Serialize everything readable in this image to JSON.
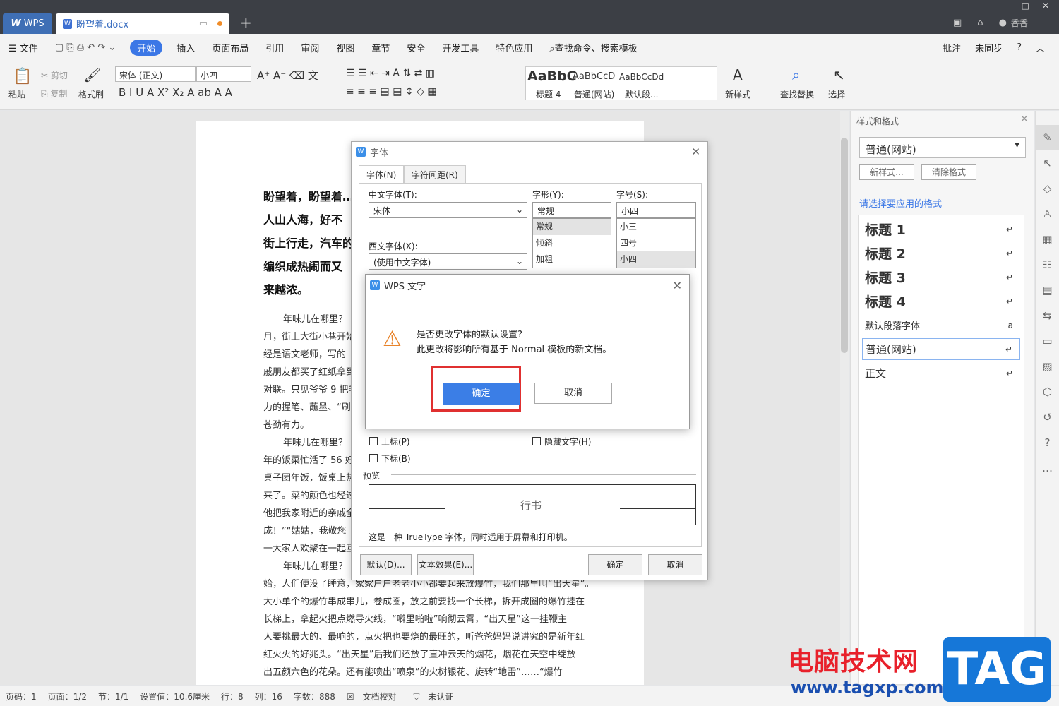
{
  "titlebar": {
    "app_tab": "WPS",
    "doc_tab": "盼望着.docx",
    "user": "香香"
  },
  "menu": {
    "items": [
      "文件",
      "开始",
      "插入",
      "页面布局",
      "引用",
      "审阅",
      "视图",
      "章节",
      "安全",
      "开发工具",
      "特色应用"
    ],
    "search": "查找命令、搜索模板",
    "right": [
      "批注",
      "未同步",
      "?"
    ]
  },
  "toolbar": {
    "paste": "粘贴",
    "cut": "剪切",
    "copy": "复制",
    "format_painter": "格式刷",
    "font": "宋体 (正文)",
    "size": "小四",
    "styles": [
      {
        "sample": "AaBbC",
        "name": "标题 4"
      },
      {
        "sample": "AaBbCcD",
        "name": "普通(网站)"
      },
      {
        "sample": "AaBbCcDd",
        "name": "默认段..."
      }
    ],
    "new_style": "新样式",
    "find_replace": "查找替换",
    "select": "选择"
  },
  "doc": {
    "bold_lines": [
      "盼望着，盼望着…",
      "人山人海，好不",
      "街上行走，汽车的",
      "编织成热闹而又",
      "来越浓。"
    ],
    "lines": [
      "年味儿在哪里？ 响",
      "月，街上大街小巷开始",
      "经是语文老师，写的",
      "戚朋友都买了红纸拿到",
      "对联。只见爷爷 9 把毛",
      "力的握笔、蘸墨、“刷",
      "苍劲有力。",
      "年味儿在哪里？ 响",
      "年的饭菜忙活了 56 好",
      "桌子团年饭，饭桌上热",
      "来了。菜的颜色也经过",
      "他把我家附近的亲戚全",
      "成！”“姑姑，我敬您",
      "一大家人欢聚在一起互",
      "年味儿在哪里？ 响",
      "始，人们便没了睡意，家家户户老老小小都要起来放爆竹，我们那里叫“出天星”。",
      "大小单个的爆竹串成串儿，卷成圈，放之前要找一个长梯，拆开成圈的爆竹挂在",
      "长梯上，拿起火把点燃导火线，“噼里啪啦”响彻云霄，“出天星”这一挂鞭主",
      "人要挑最大的、最响的，点火把也要烧的最旺的，听爸爸妈妈说讲究的是新年红",
      "红火火的好兆头。“出天星”后我们还放了直冲云天的烟花，烟花在天空中绽放",
      "出五颜六色的花朵。还有能喷出“喷泉”的火树银花、旋转“地雷”……“爆竹"
    ]
  },
  "panel": {
    "title": "样式和格式",
    "current": "普通(网站)",
    "new_style": "新样式...",
    "clear": "清除格式",
    "prompt": "请选择要应用的格式",
    "styles": [
      {
        "name": "标题  1",
        "mark": "↵"
      },
      {
        "name": "标题  2",
        "mark": "↵"
      },
      {
        "name": "标题  3",
        "mark": "↵"
      },
      {
        "name": "标题  4",
        "mark": "↵"
      },
      {
        "name": "默认段落字体",
        "mark": "a"
      },
      {
        "name": "普通(网站)",
        "mark": "↵"
      },
      {
        "name": "正文",
        "mark": "↵"
      }
    ]
  },
  "font_dialog": {
    "title": "字体",
    "tabs": [
      "字体(N)",
      "字符间距(R)"
    ],
    "cn_font_label": "中文字体(T):",
    "cn_font": "宋体",
    "west_font_label": "西文字体(X):",
    "west_font": "(使用中文字体)",
    "style_label": "字形(Y):",
    "style": "常规",
    "style_list": [
      "常规",
      "倾斜",
      "加粗"
    ],
    "size_label": "字号(S):",
    "size": "小四",
    "size_list": [
      "小三",
      "四号",
      "小四"
    ],
    "superscript": "上标(P)",
    "subscript": "下标(B)",
    "hidden": "隐藏文字(H)",
    "preview_label": "预览",
    "preview_text": "行书",
    "truetype_note": "这是一种 TrueType 字体，同时适用于屏幕和打印机。",
    "default_btn": "默认(D)...",
    "effects_btn": "文本效果(E)...",
    "ok": "确定",
    "cancel": "取消"
  },
  "confirm": {
    "title": "WPS 文字",
    "question": "是否更改字体的默认设置?",
    "detail": "此更改将影响所有基于 Normal 模板的新文档。",
    "ok": "确定",
    "cancel": "取消"
  },
  "status": {
    "items": [
      "页码：1",
      "页面：1/2",
      "节：1/1",
      "设置值：10.6厘米",
      "行：8",
      "列：16",
      "字数：888",
      "文档校对",
      "未认证"
    ]
  },
  "watermark": {
    "line1": "电脑技术网",
    "line2": "www.tagxp.com",
    "tag": "TAG"
  }
}
